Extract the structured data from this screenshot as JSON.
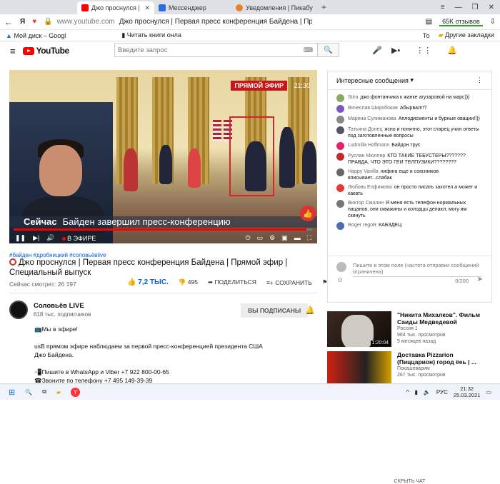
{
  "browser": {
    "tabs": [
      {
        "label": "Джо проснулся | Перв",
        "active": true
      },
      {
        "label": "Мессенджер",
        "active": false
      },
      {
        "label": "Уведомления | Пикабу",
        "active": false
      }
    ],
    "address": {
      "domain": "www.youtube.com",
      "page_title": "Джо проснулся | Первая пресс конференция Байдена | Прямо",
      "reviews": "65K отзывов"
    },
    "bookmarks": [
      "Мой диск – Googl",
      "Читать книги онла",
      "То",
      "Другие закладки"
    ],
    "yandex_glyph": "Я"
  },
  "youtube": {
    "logo": "YouTube",
    "search_placeholder": "Введите запрос"
  },
  "video": {
    "live_badge": "ПРЯМОЙ ЭФИР",
    "clock": "21:30",
    "lower_third_now": "Сейчас",
    "lower_third_text": "Байден завершил пресс-конференцию",
    "live_indicator": "В ЭФИРЕ",
    "tags": "#байден #дробницкий #соловьёвlive",
    "title": "Джо проснулся | Первая пресс конференция Байдена | Прямой эфир | Специальный выпуск",
    "viewers": "Сейчас смотрят: 26 197",
    "likes": "7,2 ТЫС.",
    "dislikes": "495",
    "share": "ПОДЕЛИТЬСЯ",
    "save": "СОХРАНИТЬ"
  },
  "channel": {
    "name": "Соловьёв LIVE",
    "subscribers": "618 тыс. подписчиков",
    "subscribed_label": "ВЫ ПОДПИСАНЫ"
  },
  "description": {
    "line1": "Мы в эфире!",
    "line2": "usВ прямом эфире наблюдаем за первой пресс-конференцией президента США Джо Байдена.",
    "line3": "Пишите в WhatsApp и Viber +7 922 800-00-65",
    "line4": "Звоните по телефону +7 495 149-39-39"
  },
  "chat": {
    "header": "Интересные сообщения",
    "messages": [
      {
        "name": "Stira",
        "text": "джо фонтанчика к жанке агузаровой на марс)))",
        "color": "#8a6"
      },
      {
        "name": "Вячеслав Широбоков",
        "text": "Абырвалг!?",
        "color": "#7e57c2"
      },
      {
        "name": "Марина Сулиманова",
        "text": "Аплодисменты и бурные овации!!))",
        "color": "#888"
      },
      {
        "name": "Татьяна Донец",
        "text": "ясно и понятно, этот старец учил ответы под заготовленные вопросы",
        "color": "#556"
      },
      {
        "name": "Ludmilla Hoffmann",
        "text": "Байдон трус",
        "color": "#e91e63"
      },
      {
        "name": "Руслан Мюллер",
        "text": "КТО ТАКИЕ ТЕБУСТЕРЫ??????? ПРАВДА, ЧТО ЭТО ГЕИ ТЕЛПУЗИКИ????????",
        "color": "#c62828"
      },
      {
        "name": "Happy Vanilla",
        "text": "нифига еще и союзников вписывает...слабак",
        "color": "#666"
      },
      {
        "name": "Любовь Елфимова",
        "text": "он просто писать захотел.а может и какать",
        "color": "#e53935"
      },
      {
        "name": "Виктор Смолин",
        "text": "Я меня есть телефон нормальных пацанов, они скважины и колодцы делают, могу им скинуть",
        "color": "#777"
      },
      {
        "name": "Roger regoR",
        "text": "КАБЗДЕЦ",
        "color": "#4e6cb5"
      }
    ],
    "input_placeholder": "Пишите в этом поле (частота отправки сообщений ограничена)",
    "counter": "0/200",
    "hide_chat": "СКРЫТЬ ЧАТ"
  },
  "recommended": [
    {
      "title": "\"Никита Михалков\". Фильм Саиды Медведевой",
      "channel": "Россия 1",
      "views": "964 тыс. просмотров",
      "age": "5 месяцев назад",
      "duration": "1:20:04"
    },
    {
      "title": "Доставка Pizzarion (Пиццарион) город ёеь | ...",
      "channel": "Покашеварим",
      "views": "267 тыс. просмотров",
      "age": "",
      "duration": ""
    }
  ],
  "taskbar": {
    "lang": "РУС",
    "time": "21:32",
    "date": "25.03.2021"
  }
}
